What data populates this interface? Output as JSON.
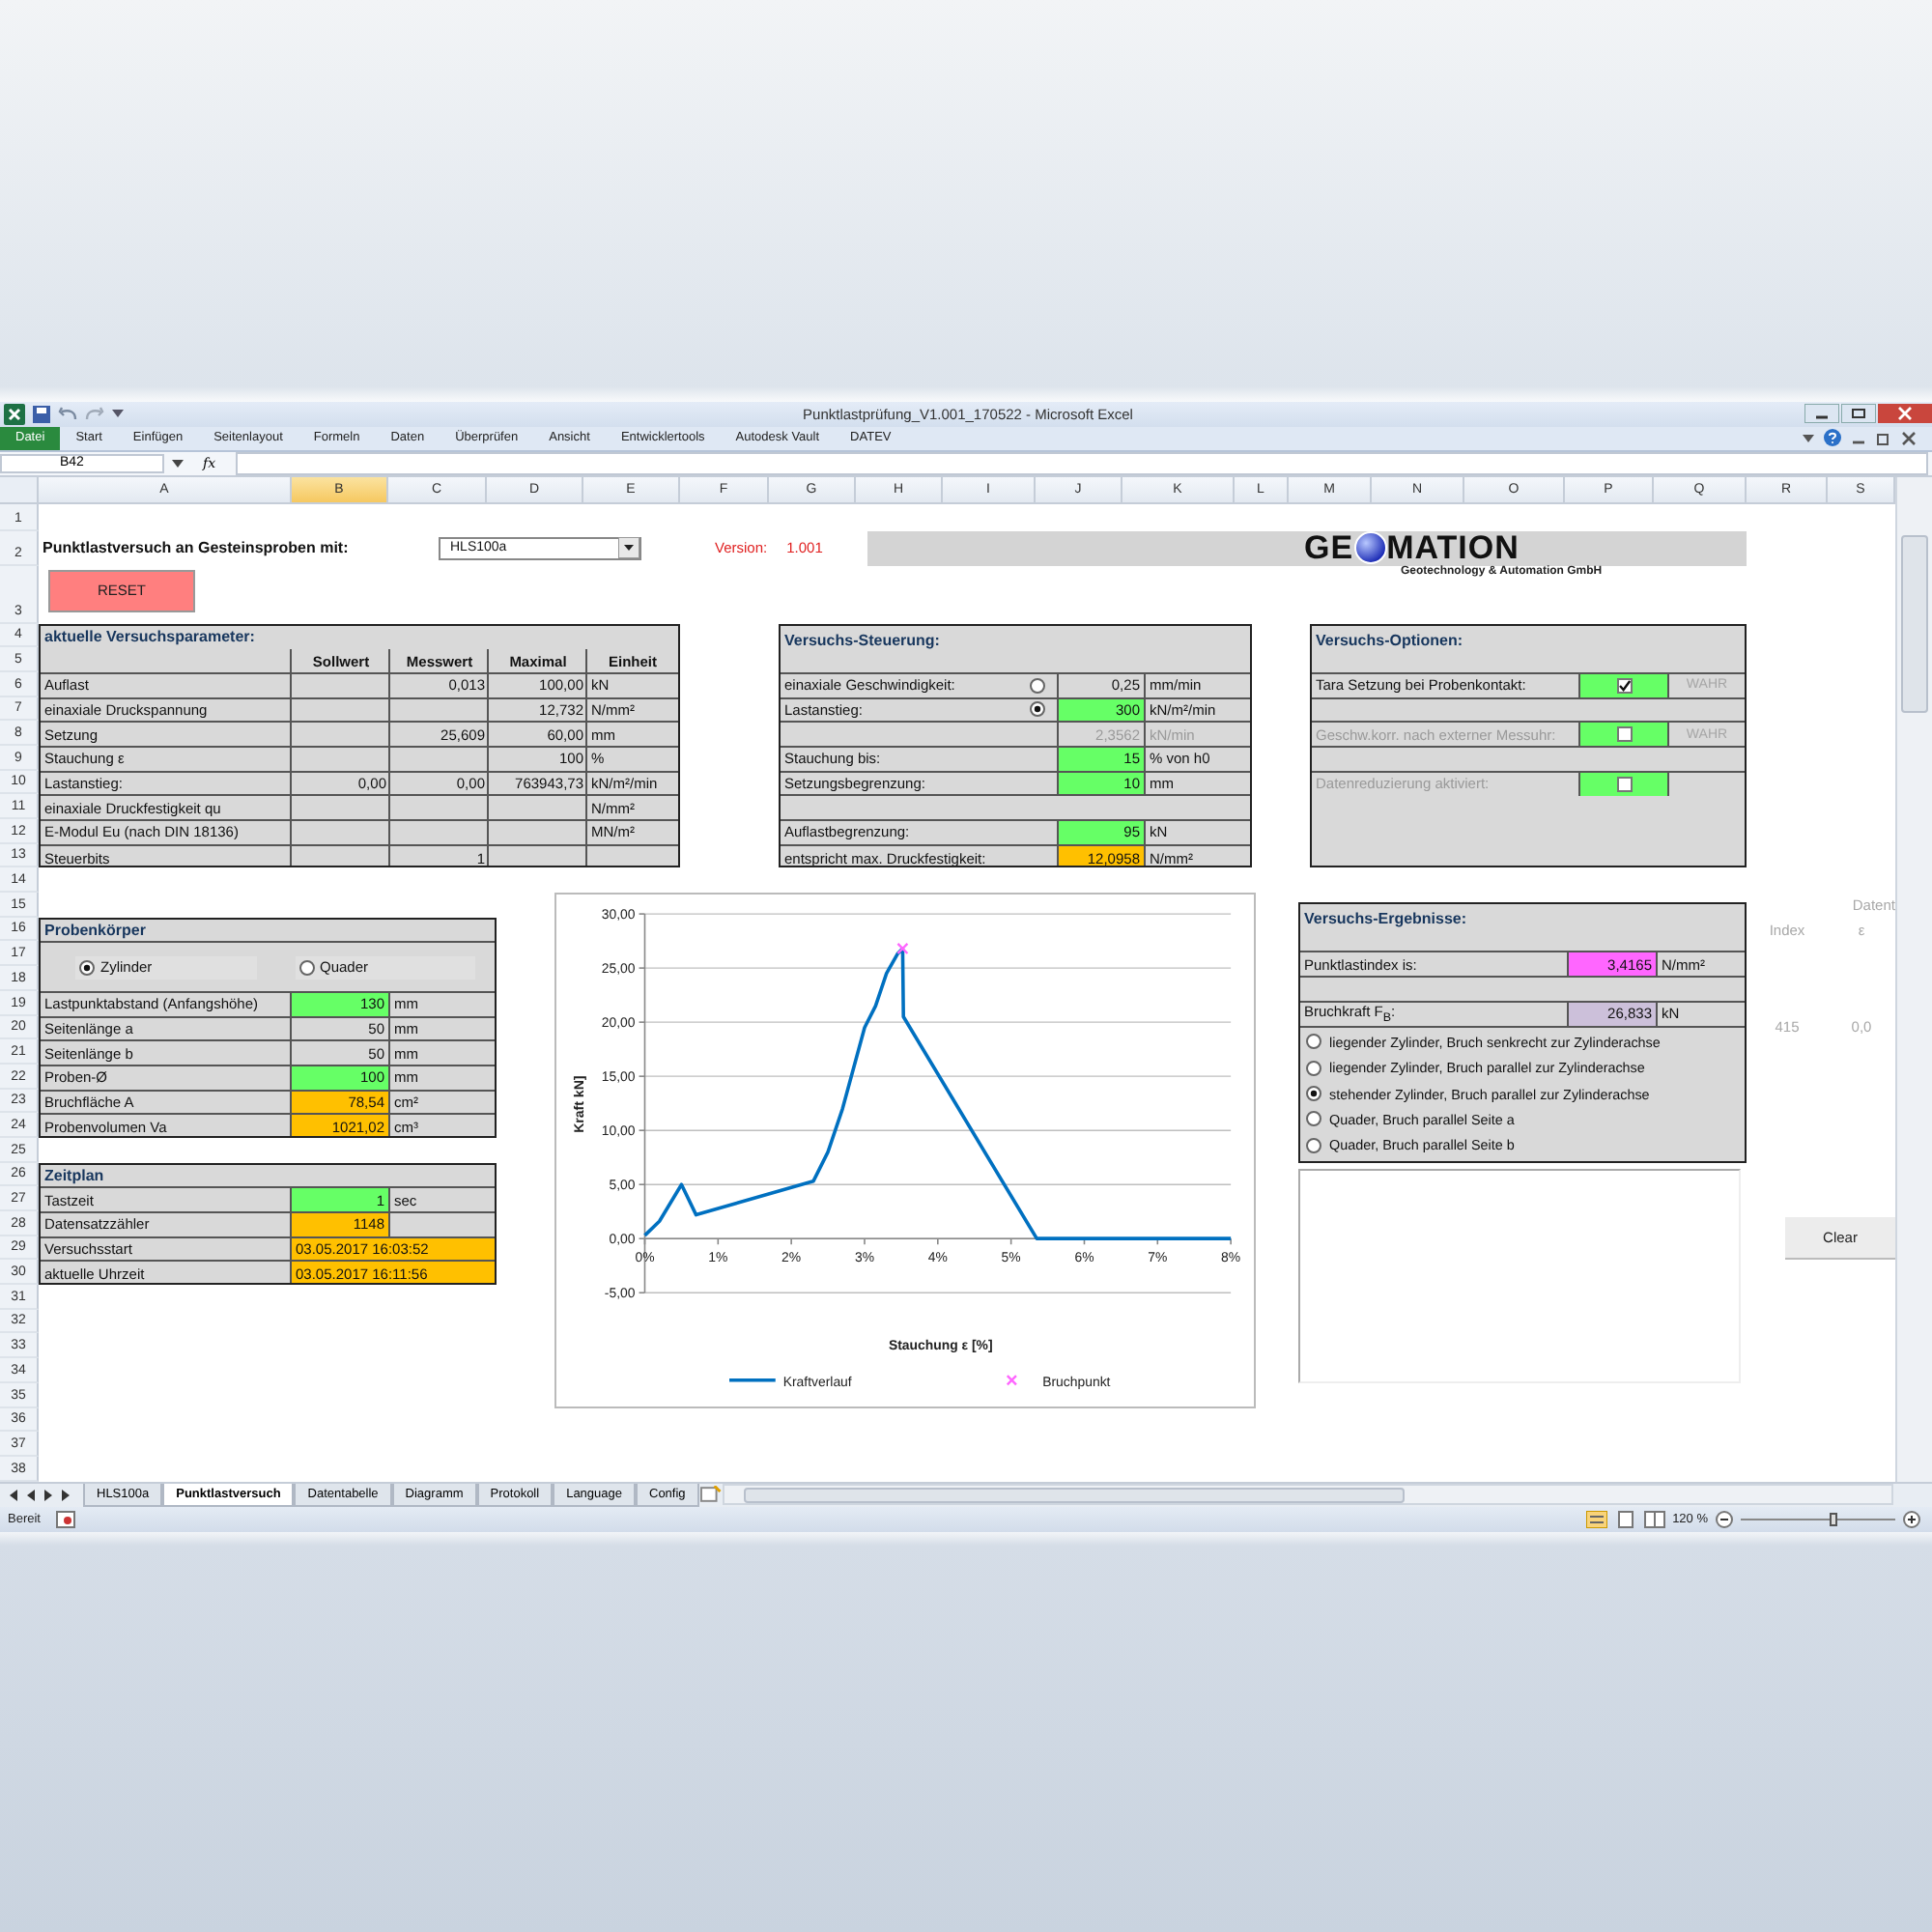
{
  "window": {
    "title": "Punktlastprüfung_V1.001_170522 - Microsoft Excel"
  },
  "ribbon_tabs": [
    {
      "label": "Datei",
      "kind": "file",
      "selected": false
    },
    {
      "label": "Start",
      "kind": "tab",
      "selected": false
    },
    {
      "label": "Einfügen",
      "kind": "tab",
      "selected": false
    },
    {
      "label": "Seitenlayout",
      "kind": "tab",
      "selected": false
    },
    {
      "label": "Formeln",
      "kind": "tab",
      "selected": false
    },
    {
      "label": "Daten",
      "kind": "tab",
      "selected": false
    },
    {
      "label": "Überprüfen",
      "kind": "tab",
      "selected": false
    },
    {
      "label": "Ansicht",
      "kind": "tab",
      "selected": false
    },
    {
      "label": "Entwicklertools",
      "kind": "tab",
      "selected": false
    },
    {
      "label": "Autodesk Vault",
      "kind": "tab",
      "selected": false
    },
    {
      "label": "DATEV",
      "kind": "tab",
      "selected": false
    }
  ],
  "formula_bar": {
    "name_box": "B42",
    "fx": "fx"
  },
  "columns": [
    {
      "label": "A",
      "selected": false
    },
    {
      "label": "B",
      "selected": true
    },
    {
      "label": "C",
      "selected": false
    },
    {
      "label": "D",
      "selected": false
    },
    {
      "label": "E",
      "selected": false
    },
    {
      "label": "F",
      "selected": false
    },
    {
      "label": "G",
      "selected": false
    },
    {
      "label": "H",
      "selected": false
    },
    {
      "label": "I",
      "selected": false
    },
    {
      "label": "J",
      "selected": false
    },
    {
      "label": "K",
      "selected": false
    },
    {
      "label": "L",
      "selected": false
    },
    {
      "label": "M",
      "selected": false
    },
    {
      "label": "N",
      "selected": false
    },
    {
      "label": "O",
      "selected": false
    },
    {
      "label": "P",
      "selected": false
    },
    {
      "label": "Q",
      "selected": false
    },
    {
      "label": "R",
      "selected": false
    },
    {
      "label": "S",
      "selected": false
    }
  ],
  "row_numbers": [
    "1",
    "2",
    "3",
    "4",
    "5",
    "6",
    "7",
    "8",
    "9",
    "10",
    "11",
    "12",
    "13",
    "14",
    "15",
    "16",
    "17",
    "18",
    "19",
    "20",
    "21",
    "22",
    "23",
    "24",
    "25",
    "26",
    "27",
    "28",
    "29",
    "30",
    "31",
    "32",
    "33",
    "34",
    "35",
    "36",
    "37",
    "38"
  ],
  "sheet": {
    "heading": "Punktlastversuch an Gesteinsproben mit:",
    "sample_dropdown": {
      "value": "HLS100a"
    },
    "version": {
      "label": "Version:",
      "value": "1.001"
    },
    "logo": {
      "text_before": "GE",
      "text_after": "MATION",
      "tagline": "Geotechnology & Automation GmbH"
    },
    "reset_button": {
      "label": "RESET"
    },
    "parameters": {
      "title": "aktuelle Versuchsparameter:",
      "columns": [
        "Sollwert",
        "Messwert",
        "Maximal",
        "Einheit"
      ],
      "rows": [
        {
          "label": "Auflast",
          "messwert": "0,013",
          "maximal": "100,00",
          "einheit": "kN"
        },
        {
          "label": "einaxiale Druckspannung",
          "maximal": "12,732",
          "einheit": "N/mm²"
        },
        {
          "label": "Setzung",
          "messwert": "25,609",
          "maximal": "60,00",
          "einheit": "mm"
        },
        {
          "label": "Stauchung ε",
          "maximal": "100",
          "einheit": "%"
        },
        {
          "label": "Lastanstieg:",
          "sollwert": "0,00",
          "messwert": "0,00",
          "maximal": "763943,73",
          "einheit": "kN/m²/min"
        },
        {
          "label": "einaxiale Druckfestigkeit qu",
          "einheit": "N/mm²"
        },
        {
          "label": "E-Modul Eu (nach DIN 18136)",
          "einheit": "MN/m²"
        },
        {
          "label": "Steuerbits",
          "messwert": "1"
        }
      ]
    },
    "control": {
      "title": "Versuchs-Steuerung:",
      "rows": [
        {
          "kind": "radio",
          "label": "einaxiale Geschwindigkeit:",
          "selected": false,
          "value": "0,25",
          "unit": "mm/min",
          "disabled": false
        },
        {
          "kind": "radio",
          "label": "Lastanstieg:",
          "selected": true,
          "value": "300",
          "unit": "kN/m²/min",
          "color": "#66ff66",
          "disabled": false
        },
        {
          "kind": "value",
          "value": "2,3562",
          "unit": "kN/min",
          "disabled": true
        },
        {
          "kind": "value",
          "label": "Stauchung bis:",
          "value": "15",
          "unit": "% von h0",
          "color": "#66ff66",
          "disabled": false
        },
        {
          "kind": "value",
          "label": "Setzungsbegrenzung:",
          "value": "10",
          "unit": "mm",
          "color": "#66ff66",
          "disabled": false
        },
        {
          "kind": "blank"
        },
        {
          "kind": "value",
          "label": "Auflastbegrenzung:",
          "value": "95",
          "unit": "kN",
          "color": "#66ff66",
          "disabled": false
        },
        {
          "kind": "value",
          "label": "entspricht max. Druckfestigkeit:",
          "value": "12,0958",
          "unit": "N/mm²",
          "color": "#ffc000",
          "disabled": false
        }
      ]
    },
    "options": {
      "title": "Versuchs-Optionen:",
      "rows": [
        {
          "kind": "check",
          "label": "Tara Setzung bei Probenkontakt:",
          "checked": true,
          "disabled": false,
          "status": "WAHR"
        },
        {
          "kind": "blank"
        },
        {
          "kind": "check",
          "label": "Geschw.korr. nach externer Messuhr:",
          "checked": false,
          "disabled": true,
          "status": "WAHR"
        },
        {
          "kind": "blank"
        },
        {
          "kind": "check",
          "label": "Datenreduzierung aktiviert:",
          "checked": false,
          "disabled": true
        }
      ]
    },
    "specimen": {
      "title": "Probenkörper",
      "shapes": [
        {
          "label": "Zylinder",
          "selected": true
        },
        {
          "label": "Quader",
          "selected": false
        }
      ],
      "rows": [
        {
          "label": "Lastpunktabstand (Anfangshöhe)",
          "value": "130",
          "unit": "mm",
          "color": "#66ff66"
        },
        {
          "label": "Seitenlänge a",
          "value": "50",
          "unit": "mm"
        },
        {
          "label": "Seitenlänge b",
          "value": "50",
          "unit": "mm"
        },
        {
          "label": "Proben-Ø",
          "value": "100",
          "unit": "mm",
          "color": "#66ff66"
        },
        {
          "label": "Bruchfläche A",
          "value": "78,54",
          "unit": "cm²",
          "color": "#ffc000"
        },
        {
          "label": "Probenvolumen Va",
          "value": "1021,02",
          "unit": "cm³",
          "color": "#ffc000"
        }
      ]
    },
    "schedule": {
      "title": "Zeitplan",
      "rows": [
        {
          "kind": "value",
          "label": "Tastzeit",
          "value": "1",
          "unit": "sec",
          "color": "#66ff66"
        },
        {
          "kind": "value",
          "label": "Datensatzzähler",
          "value": "1148",
          "color": "#ffc000"
        },
        {
          "kind": "timestamp",
          "label": "Versuchsstart",
          "value": "03.05.2017 16:03:52",
          "color": "#ffc000"
        },
        {
          "kind": "timestamp",
          "label": "aktuelle Uhrzeit",
          "value": "03.05.2017 16:11:56",
          "color": "#ffc000"
        }
      ]
    },
    "chart": {
      "chart_data": {
        "type": "line",
        "xlabel": "Stauchung ε [%]",
        "ylabel": "Kraft kN]",
        "grid": true,
        "legend": true,
        "x": [
          0,
          0.2,
          0.5,
          0.7,
          2.3,
          2.5,
          2.7,
          3.0,
          3.15,
          3.3,
          3.45,
          3.52,
          3.53,
          5.35,
          8
        ],
        "series": [
          {
            "name": "Kraftverlauf",
            "color": "#0070c0",
            "values": [
              0.3,
              1.6,
              5.0,
              2.2,
              5.3,
              8.0,
              12.0,
              19.5,
              21.5,
              24.5,
              26.3,
              26.8,
              20.5,
              0,
              0
            ]
          },
          {
            "name": "Bruchpunkt",
            "color": "#ff66ff",
            "marker": "x",
            "values": [
              null,
              null,
              null,
              null,
              null,
              null,
              null,
              null,
              null,
              null,
              null,
              26.8,
              null,
              null,
              null
            ]
          }
        ],
        "xlim": [
          0,
          8
        ],
        "ylim": [
          -5,
          30
        ],
        "xticks": [
          {
            "value": 0,
            "label": "0%"
          },
          {
            "value": 1,
            "label": "1%"
          },
          {
            "value": 2,
            "label": "2%"
          },
          {
            "value": 3,
            "label": "3%"
          },
          {
            "value": 4,
            "label": "4%"
          },
          {
            "value": 5,
            "label": "5%"
          },
          {
            "value": 6,
            "label": "6%"
          },
          {
            "value": 7,
            "label": "7%"
          },
          {
            "value": 8,
            "label": "8%"
          }
        ],
        "yticks": [
          {
            "value": -5,
            "label": "-5,00"
          },
          {
            "value": 0,
            "label": "0,00"
          },
          {
            "value": 5,
            "label": "5,00"
          },
          {
            "value": 10,
            "label": "10,00"
          },
          {
            "value": 15,
            "label": "15,00"
          },
          {
            "value": 20,
            "label": "20,00"
          },
          {
            "value": 25,
            "label": "25,00"
          },
          {
            "value": 30,
            "label": "30,00"
          }
        ]
      }
    },
    "results": {
      "title": "Versuchs-Ergebnisse:",
      "rows": [
        {
          "kind": "value",
          "label": "Punktlastindex is:",
          "value": "3,4165",
          "unit": "N/mm²",
          "color": "#ff66ff"
        },
        {
          "kind": "blank"
        },
        {
          "kind": "value",
          "label": "Bruchkraft F$_{B}$:",
          "value": "26,833",
          "unit": "kN",
          "color": "#ccc0da"
        }
      ],
      "fracture_modes": [
        {
          "label": "liegender Zylinder, Bruch senkrecht zur Zylinderachse",
          "selected": false
        },
        {
          "label": "liegender Zylinder, Bruch parallel zur Zylinderachse",
          "selected": false
        },
        {
          "label": "stehender Zylinder, Bruch parallel zur Zylinderachse",
          "selected": true
        },
        {
          "label": "Quader, Bruch parallel Seite a",
          "selected": false
        },
        {
          "label": "Quader, Bruch parallel Seite b",
          "selected": false
        }
      ]
    },
    "data_preview": {
      "column_1": "Index",
      "column_2_title": "Datent",
      "column_2_unit": "ε",
      "values": [
        "415",
        "0,0"
      ]
    },
    "clear_button": {
      "label": "Clear"
    }
  },
  "sheet_tabs": [
    {
      "label": "HLS100a",
      "selected": false
    },
    {
      "label": "Punktlastversuch",
      "selected": true
    },
    {
      "label": "Datentabelle",
      "selected": false
    },
    {
      "label": "Diagramm",
      "selected": false
    },
    {
      "label": "Protokoll",
      "selected": false
    },
    {
      "label": "Language",
      "selected": false
    },
    {
      "label": "Config",
      "selected": false
    }
  ],
  "status_bar": {
    "status": "Bereit",
    "zoom": "120 %",
    "zoom_slider": {
      "level": 0.6
    }
  }
}
